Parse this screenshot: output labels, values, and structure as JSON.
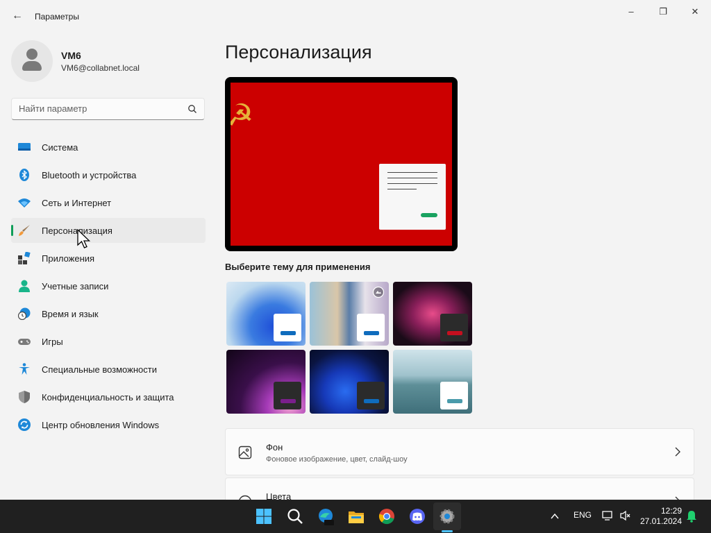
{
  "window": {
    "title": "Параметры",
    "back_icon": "back-arrow-icon",
    "controls": [
      "minimize-icon",
      "restore-icon",
      "close-icon"
    ]
  },
  "user": {
    "name": "VM6",
    "email": "VM6@collabnet.local"
  },
  "search": {
    "placeholder": "Найти параметр",
    "icon": "search-icon"
  },
  "sidebar": {
    "items": [
      {
        "label": "Система",
        "icon": "system-icon"
      },
      {
        "label": "Bluetooth и устройства",
        "icon": "bluetooth-icon"
      },
      {
        "label": "Сеть и Интернет",
        "icon": "wifi-icon"
      },
      {
        "label": "Персонализация",
        "icon": "brush-icon",
        "active": true
      },
      {
        "label": "Приложения",
        "icon": "apps-icon"
      },
      {
        "label": "Учетные записи",
        "icon": "account-icon"
      },
      {
        "label": "Время и язык",
        "icon": "time-language-icon"
      },
      {
        "label": "Игры",
        "icon": "gamepad-icon"
      },
      {
        "label": "Специальные возможности",
        "icon": "accessibility-icon"
      },
      {
        "label": "Конфиденциальность и защита",
        "icon": "shield-icon"
      },
      {
        "label": "Центр обновления Windows",
        "icon": "update-icon"
      }
    ]
  },
  "main": {
    "title": "Персонализация",
    "themes_label": "Выберите тему для применения",
    "themes": [
      {
        "name": "windows-light",
        "accent": "#0f6cbd"
      },
      {
        "name": "glow",
        "accent": "#0f6cbd"
      },
      {
        "name": "captured-motion",
        "accent": "#c50f1f"
      },
      {
        "name": "sunrise",
        "accent": "#7a1f8c"
      },
      {
        "name": "windows-dark",
        "accent": "#0f6cbd"
      },
      {
        "name": "flow",
        "accent": "#4a9bab"
      }
    ],
    "cards": [
      {
        "title": "Фон",
        "subtitle": "Фоновое изображение, цвет, слайд-шоу",
        "icon": "image-icon"
      },
      {
        "title": "Цвета",
        "subtitle": "",
        "icon": "palette-icon"
      }
    ]
  },
  "colors": {
    "accent": "#0f9d58",
    "wallpaper": "#cc0000",
    "taskbar": "#202020"
  },
  "taskbar": {
    "apps": [
      "start-icon",
      "search-icon",
      "edge-icon",
      "file-explorer-icon",
      "chrome-icon",
      "discord-icon",
      "settings-icon"
    ],
    "lang": "ENG",
    "time": "12:29",
    "date": "27.01.2024"
  }
}
